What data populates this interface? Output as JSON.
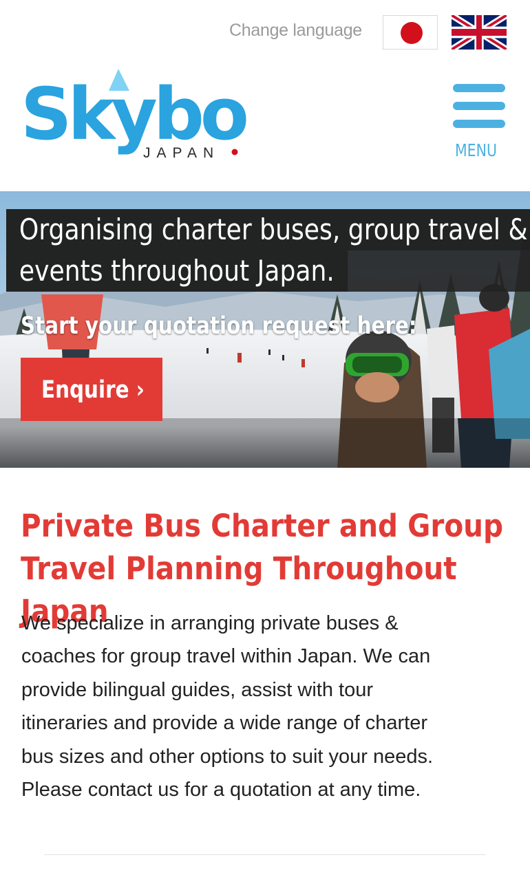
{
  "header": {
    "change_language_label": "Change language",
    "flags": [
      {
        "name": "Japanese",
        "icon": "japan-flag-icon"
      },
      {
        "name": "English",
        "icon": "uk-flag-icon"
      }
    ],
    "logo": {
      "name": "Skybo",
      "sub": "JAPAN"
    },
    "menu_label": "MENU"
  },
  "hero": {
    "title_line1": "Organising charter buses, group travel &",
    "title_line2": "events throughout Japan.",
    "subtitle": "Start your quotation request here:",
    "cta_label": "Enquire ›"
  },
  "content": {
    "heading_line1": "Private Bus Charter and Group",
    "heading_line2": "Travel Planning Throughout Japan",
    "paragraph_lines": [
      "We specialize in arranging private buses &",
      "coaches for group travel within Japan. We can",
      "provide bilingual guides, assist with tour",
      "itineraries and provide a wide range of charter",
      "bus sizes and other options to suit your needs.",
      "Please contact us for a quotation at any time."
    ]
  },
  "colors": {
    "brand_blue": "#2aa3df",
    "menu_blue": "#4cb1e1",
    "accent_red": "#e23b36",
    "japan_red": "#d1101c"
  }
}
